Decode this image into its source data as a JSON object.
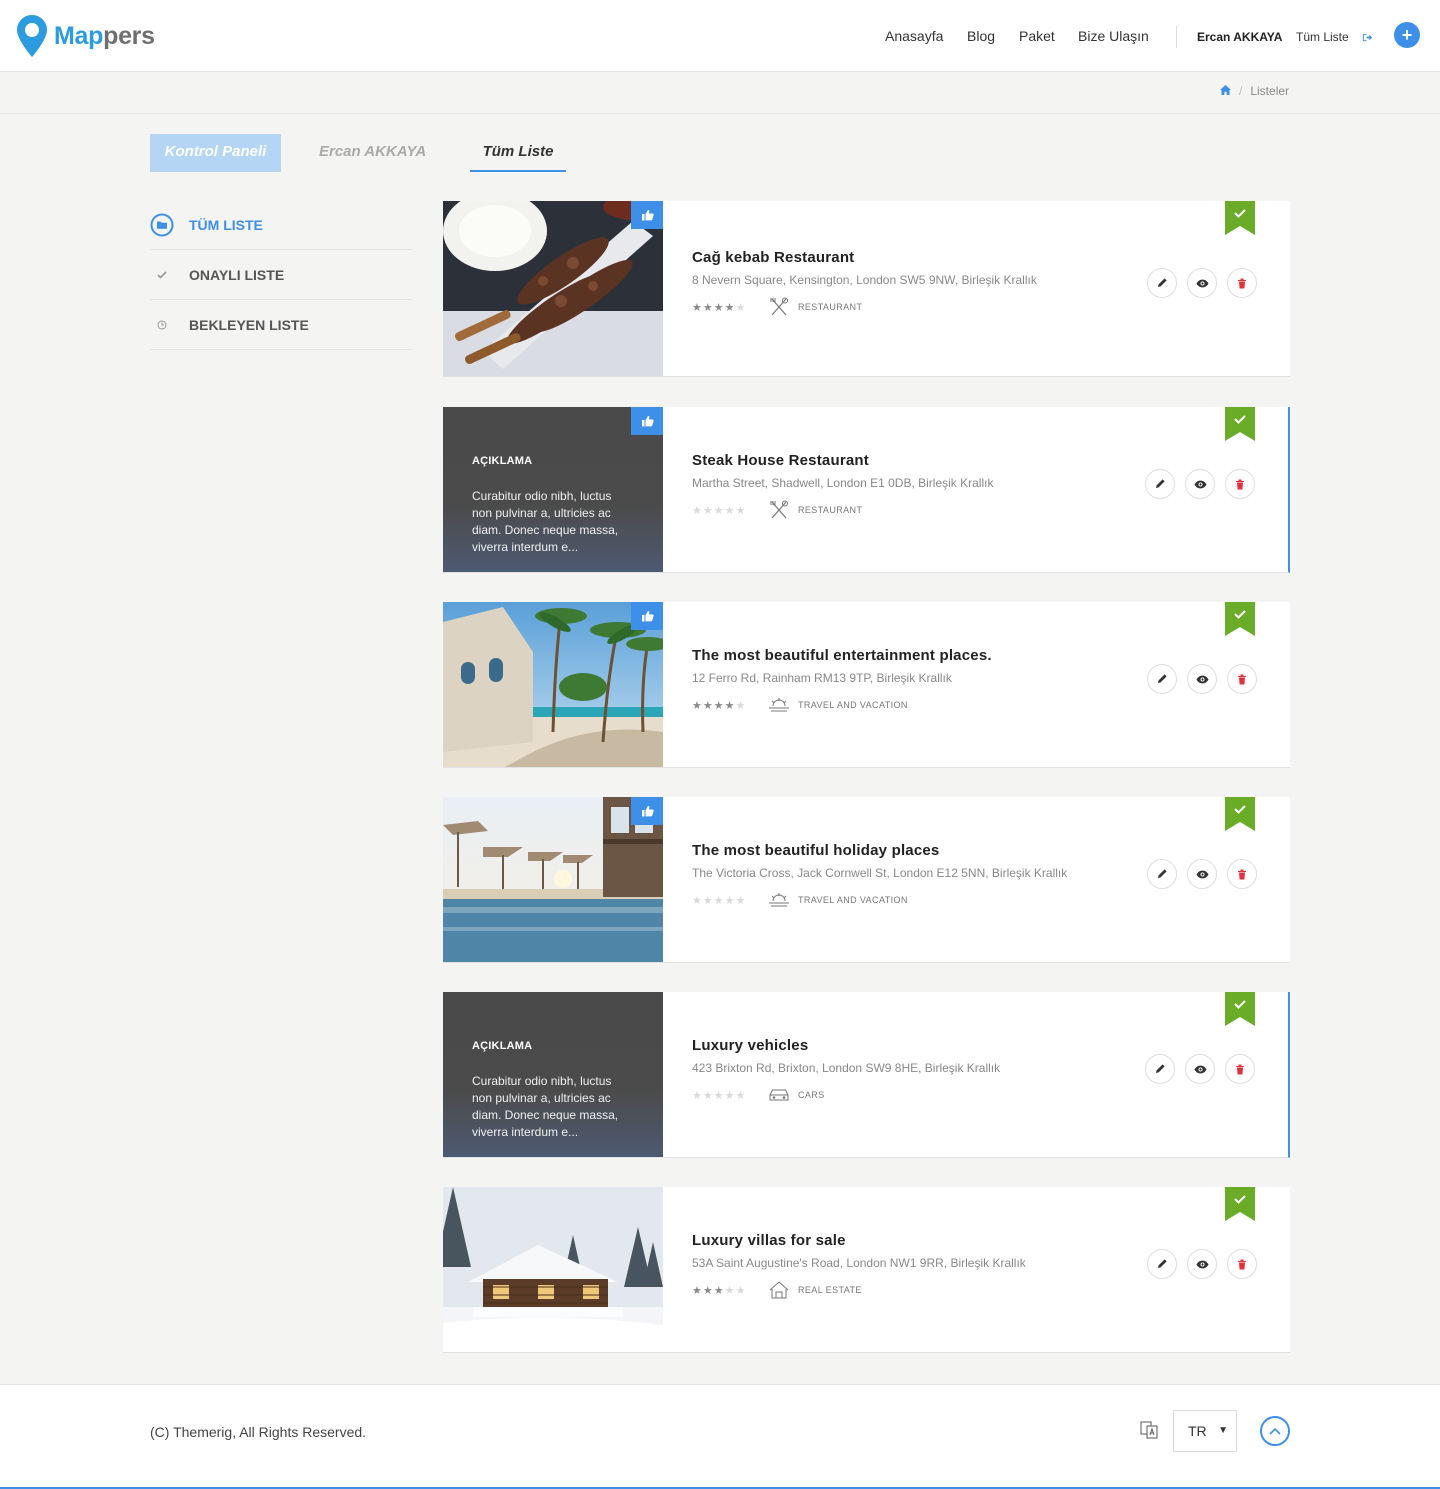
{
  "header": {
    "logo_primary": "Map",
    "logo_secondary": "pers",
    "nav": [
      "Anasayfa",
      "Blog",
      "Paket",
      "Bize Ulaşın"
    ],
    "user_name": "Ercan AKKAYA",
    "all_list_link": "Tüm Liste",
    "add_label": "+"
  },
  "breadcrumb": {
    "current": "Listeler",
    "separator": "/"
  },
  "tabs": {
    "dashboard": "Kontrol Paneli",
    "user": "Ercan AKKAYA",
    "all": "Tüm Liste"
  },
  "sidebar": {
    "items": [
      {
        "label": "TÜM LISTE",
        "icon": "folder-icon",
        "active": true
      },
      {
        "label": "ONAYLI LISTE",
        "icon": "check-icon",
        "active": false
      },
      {
        "label": "BEKLEYEN LISTE",
        "icon": "clock-icon",
        "active": false
      }
    ]
  },
  "listings": [
    {
      "title": "Cağ kebab Restaurant",
      "address": "8 Nevern Square, Kensington, London SW5 9NW, Birleşik Krallık",
      "rating": 4,
      "category": "RESTAURANT",
      "category_icon": "utensils-icon",
      "image": "kebab-photo",
      "liked": true
    },
    {
      "title": "Steak House Restaurant",
      "address": "Martha Street, Shadwell, London E1 0DB, Birleşik Krallık",
      "rating": 0,
      "category": "RESTAURANT",
      "category_icon": "utensils-icon",
      "image": null,
      "description_label": "AÇIKLAMA",
      "description": "Curabitur odio nibh, luctus non pulvinar a, ultricies ac diam. Donec neque massa, viverra interdum e...",
      "liked": true
    },
    {
      "title": "The most beautiful entertainment places.",
      "address": "12 Ferro Rd, Rainham RM13 9TP, Birleşik Krallık",
      "rating": 4,
      "category": "TRAVEL AND VACATION",
      "category_icon": "sun-icon",
      "image": "beach-photo",
      "liked": true
    },
    {
      "title": "The most beautiful holiday places",
      "address": "The Victoria Cross, Jack Cornwell St, London E12 5NN, Birleşik Krallık",
      "rating": 0,
      "category": "TRAVEL AND VACATION",
      "category_icon": "sun-icon",
      "image": "pool-photo",
      "liked": true
    },
    {
      "title": "Luxury vehicles",
      "address": "423 Brixton Rd, Brixton, London SW9 8HE, Birleşik Krallık",
      "rating": 0,
      "category": "CARS",
      "category_icon": "car-icon",
      "image": null,
      "description_label": "AÇIKLAMA",
      "description": "Curabitur odio nibh, luctus non pulvinar a, ultricies ac diam. Donec neque massa, viverra interdum e...",
      "liked": false
    },
    {
      "title": "Luxury villas for sale",
      "address": "53A Saint Augustine's Road, London NW1 9RR, Birleşik Krallık",
      "rating": 3,
      "category": "REAL ESTATE",
      "category_icon": "house-icon",
      "image": "cabin-photo",
      "liked": false
    }
  ],
  "footer": {
    "copyright": "(C) Themerig, All Rights Reserved.",
    "language": "TR"
  },
  "colors": {
    "accent": "#3d8fe8",
    "ribbon": "#6aab27",
    "delete": "#e0323a"
  }
}
